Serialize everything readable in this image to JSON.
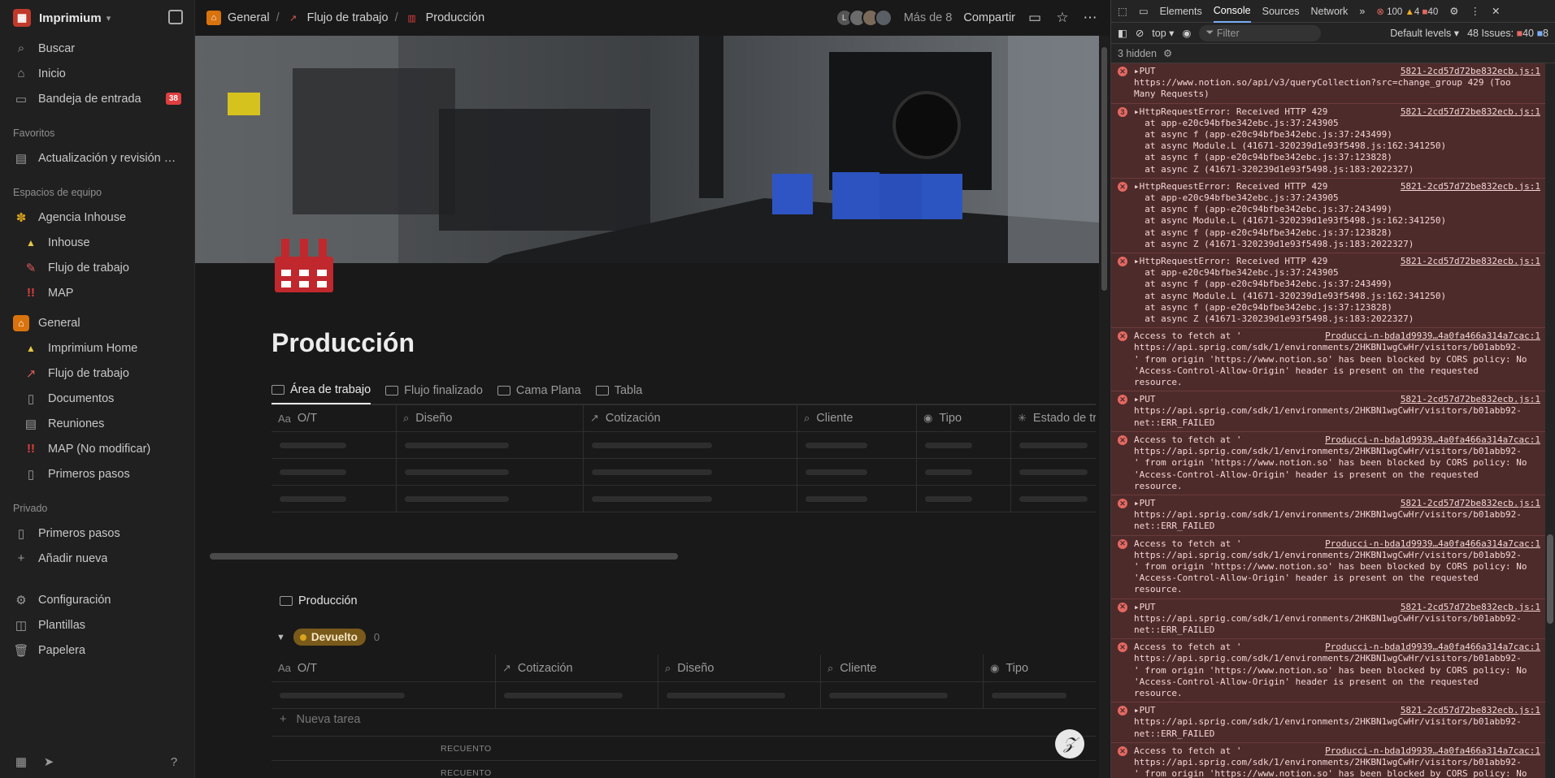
{
  "sidebar": {
    "workspace": "Imprimium",
    "top_items": [
      {
        "label": "Buscar",
        "icon": "search-icon"
      },
      {
        "label": "Inicio",
        "icon": "home-icon"
      },
      {
        "label": "Bandeja de entrada",
        "icon": "inbox-icon",
        "badge": "38"
      }
    ],
    "favorites_title": "Favoritos",
    "favorites": [
      {
        "label": "Actualización y revisión se..."
      }
    ],
    "team_title": "Espacios de equipo",
    "teams": [
      {
        "label": "Agencia Inhouse",
        "children": [
          "Inhouse",
          "Flujo de trabajo",
          "MAP"
        ]
      },
      {
        "label": "General",
        "children": [
          "Imprimium Home",
          "Flujo de trabajo",
          "Documentos",
          "Reuniones",
          "MAP (No modificar)",
          "Primeros pasos"
        ]
      }
    ],
    "private_title": "Privado",
    "private": [
      "Primeros pasos",
      "Añadir nueva"
    ],
    "bottom": [
      "Configuración",
      "Plantillas",
      "Papelera"
    ]
  },
  "topbar": {
    "crumbs": [
      "General",
      "Flujo de trabajo",
      "Producción"
    ],
    "avatars": [
      "L",
      "",
      "",
      ""
    ],
    "more": "Más de 8",
    "share": "Compartir"
  },
  "page": {
    "title": "Producción",
    "tabs": [
      "Área de trabajo",
      "Flujo finalizado",
      "Cama Plana",
      "Tabla"
    ],
    "columns1": [
      "O/T",
      "Diseño",
      "Cotización",
      "Cliente",
      "Tipo",
      "Estado de tr"
    ],
    "col1_prefix": "Aa",
    "section_title": "Producción",
    "group_label": "Devuelto",
    "group_count": "0",
    "columns2": [
      "O/T",
      "Cotización",
      "Diseño",
      "Cliente",
      "Tipo"
    ],
    "new_task": "Nueva tarea",
    "recuento": "RECUENTO"
  },
  "devtools": {
    "tabs": [
      "Elements",
      "Console",
      "Sources",
      "Network"
    ],
    "errors": "100",
    "warnings": "4",
    "issues_badge": "40",
    "context": "top",
    "filter": "Filter",
    "levels": "Default levels",
    "issues": "48 Issues:",
    "issues_count": "40",
    "issues_count2": "8",
    "hidden": "3 hidden",
    "messages": [
      {
        "head": "▸PUT",
        "src": "5821-2cd57d72be832ecb.js:1",
        "lines": [
          "https://www.notion.so/api/v3/queryCollection?src=change_group 429 (Too",
          "Many Requests)"
        ]
      },
      {
        "head": "▸HttpRequestError: Received HTTP 429",
        "src": "5821-2cd57d72be832ecb.js:1",
        "badge": "3",
        "lines": [
          "  at app-e20c94bfbe342ebc.js:37:243905",
          "  at async f (app-e20c94bfbe342ebc.js:37:243499)",
          "  at async Module.L (41671-320239d1e93f5498.js:162:341250)",
          "  at async f (app-e20c94bfbe342ebc.js:37:123828)",
          "  at async Z (41671-320239d1e93f5498.js:183:2022327)"
        ]
      },
      {
        "head": "▸HttpRequestError: Received HTTP 429",
        "src": "5821-2cd57d72be832ecb.js:1",
        "lines": [
          "  at app-e20c94bfbe342ebc.js:37:243905",
          "  at async f (app-e20c94bfbe342ebc.js:37:243499)",
          "  at async Module.L (41671-320239d1e93f5498.js:162:341250)",
          "  at async f (app-e20c94bfbe342ebc.js:37:123828)",
          "  at async Z (41671-320239d1e93f5498.js:183:2022327)"
        ]
      },
      {
        "head": "▸HttpRequestError: Received HTTP 429",
        "src": "5821-2cd57d72be832ecb.js:1",
        "lines": [
          "  at app-e20c94bfbe342ebc.js:37:243905",
          "  at async f (app-e20c94bfbe342ebc.js:37:243499)",
          "  at async Module.L (41671-320239d1e93f5498.js:162:341250)",
          "  at async f (app-e20c94bfbe342ebc.js:37:123828)",
          "  at async Z (41671-320239d1e93f5498.js:183:2022327)"
        ]
      },
      {
        "head": "Access to fetch at '",
        "src": "Producci-n-bda1d9939…4a0fa466a314a7cac:1",
        "lines": [
          "https://api.sprig.com/sdk/1/environments/2HKBN1wgCwHr/visitors/b01abb92-",
          "' from origin 'https://www.notion.so' has been blocked by CORS policy: No",
          "'Access-Control-Allow-Origin' header is present on the requested",
          "resource."
        ]
      },
      {
        "head": "▸PUT",
        "src": "5821-2cd57d72be832ecb.js:1",
        "lines": [
          "https://api.sprig.com/sdk/1/environments/2HKBN1wgCwHr/visitors/b01abb92-",
          "net::ERR_FAILED"
        ]
      },
      {
        "head": "Access to fetch at '",
        "src": "Producci-n-bda1d9939…4a0fa466a314a7cac:1",
        "lines": [
          "https://api.sprig.com/sdk/1/environments/2HKBN1wgCwHr/visitors/b01abb92-",
          "' from origin 'https://www.notion.so' has been blocked by CORS policy: No",
          "'Access-Control-Allow-Origin' header is present on the requested",
          "resource."
        ]
      },
      {
        "head": "▸PUT",
        "src": "5821-2cd57d72be832ecb.js:1",
        "lines": [
          "https://api.sprig.com/sdk/1/environments/2HKBN1wgCwHr/visitors/b01abb92-",
          "net::ERR_FAILED"
        ]
      },
      {
        "head": "Access to fetch at '",
        "src": "Producci-n-bda1d9939…4a0fa466a314a7cac:1",
        "lines": [
          "https://api.sprig.com/sdk/1/environments/2HKBN1wgCwHr/visitors/b01abb92-",
          "' from origin 'https://www.notion.so' has been blocked by CORS policy: No",
          "'Access-Control-Allow-Origin' header is present on the requested",
          "resource."
        ]
      },
      {
        "head": "▸PUT",
        "src": "5821-2cd57d72be832ecb.js:1",
        "lines": [
          "https://api.sprig.com/sdk/1/environments/2HKBN1wgCwHr/visitors/b01abb92-",
          "net::ERR_FAILED"
        ]
      },
      {
        "head": "Access to fetch at '",
        "src": "Producci-n-bda1d9939…4a0fa466a314a7cac:1",
        "lines": [
          "https://api.sprig.com/sdk/1/environments/2HKBN1wgCwHr/visitors/b01abb92-",
          "' from origin 'https://www.notion.so' has been blocked by CORS policy: No",
          "'Access-Control-Allow-Origin' header is present on the requested",
          "resource."
        ]
      },
      {
        "head": "▸PUT",
        "src": "5821-2cd57d72be832ecb.js:1",
        "lines": [
          "https://api.sprig.com/sdk/1/environments/2HKBN1wgCwHr/visitors/b01abb92-",
          "net::ERR_FAILED"
        ]
      },
      {
        "head": "Access to fetch at '",
        "src": "Producci-n-bda1d9939…4a0fa466a314a7cac:1",
        "lines": [
          "https://api.sprig.com/sdk/1/environments/2HKBN1wgCwHr/visitors/b01abb92-",
          "' from origin 'https://www.notion.so' has been blocked by CORS policy: No"
        ]
      }
    ]
  },
  "colors": {
    "accent_red": "#e03e3e",
    "pill": "#7a5a1a",
    "console_error_bg": "#4e2b2b"
  }
}
